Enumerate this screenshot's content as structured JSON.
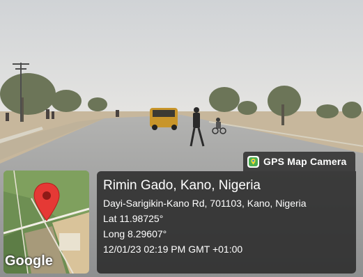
{
  "overlay": {
    "app_badge": "GPS Map Camera",
    "map_logo": "Google",
    "place_title": "Rimin Gado, Kano, Nigeria",
    "address": "Dayi-Sarigikin-Kano Rd, 701103, Kano, Nigeria",
    "latitude": "Lat 11.98725°",
    "longitude": "Long 8.29607°",
    "datetime": "12/01/23 02:19 PM GMT +01:00"
  },
  "icons": {
    "app_badge_icon": "map-pin-app-icon",
    "map_marker": "map-marker-icon"
  },
  "colors": {
    "card_bg": "#262626",
    "marker": "#e53935",
    "sky": "#d8dbde",
    "road": "#9a9b9c"
  }
}
